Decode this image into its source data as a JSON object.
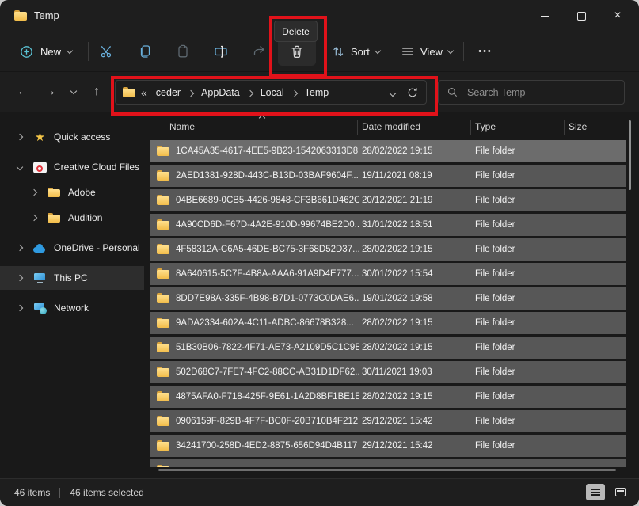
{
  "colors": {
    "annotation_red": "#e1121a",
    "accent_blue": "#6ab1dd",
    "teal_accent": "#5bc4d6",
    "selection_gray": "#575757",
    "focused_row_gray": "#6c6c6c",
    "window_bg": "#1e1e1e",
    "folder_yellow": "#f2bc49"
  },
  "glyphs": {
    "back": "←",
    "forward": "→",
    "up": "↑",
    "overflow": "«",
    "more": "•••",
    "close": "×"
  },
  "window": {
    "title": "Temp"
  },
  "toolbar": {
    "new_label": "New",
    "sort_label": "Sort",
    "view_label": "View",
    "delete_tooltip": "Delete"
  },
  "address_bar": {
    "crumbs": [
      {
        "label": "ceder"
      },
      {
        "label": "AppData"
      },
      {
        "label": "Local"
      },
      {
        "label": "Temp"
      }
    ],
    "search_placeholder": "Search Temp"
  },
  "sidebar": [
    {
      "label": "Quick access",
      "icon": "star",
      "mods": []
    },
    {
      "label": "Creative Cloud Files",
      "icon": "cc",
      "mods": [
        "gap",
        "expanded"
      ]
    },
    {
      "label": "Adobe",
      "icon": "folder",
      "mods": [
        "indent"
      ]
    },
    {
      "label": "Audition",
      "icon": "folder",
      "mods": [
        "indent"
      ]
    },
    {
      "label": "OneDrive - Personal",
      "icon": "onedrive",
      "mods": [
        "gap"
      ]
    },
    {
      "label": "This PC",
      "icon": "pc",
      "mods": [
        "gap",
        "selected"
      ]
    },
    {
      "label": "Network",
      "icon": "network",
      "mods": [
        "gap"
      ]
    }
  ],
  "file_list": {
    "columns": {
      "name": "Name",
      "date": "Date modified",
      "type": "Type",
      "size": "Size"
    },
    "sorted_by": "Name",
    "rows": [
      {
        "name": "1CA45A35-4617-4EE5-9B23-1542063313D8",
        "date": "28/02/2022 19:15",
        "type": "File folder",
        "size": "",
        "mods": [
          "focused"
        ]
      },
      {
        "name": "2AED1381-928D-443C-B13D-03BAF9604F...",
        "date": "19/11/2021 08:19",
        "type": "File folder",
        "size": "",
        "mods": []
      },
      {
        "name": "04BE6689-0CB5-4426-9848-CF3B661D462C",
        "date": "20/12/2021 21:19",
        "type": "File folder",
        "size": "",
        "mods": []
      },
      {
        "name": "4A90CD6D-F67D-4A2E-910D-99674BE2D0...",
        "date": "31/01/2022 18:51",
        "type": "File folder",
        "size": "",
        "mods": []
      },
      {
        "name": "4F58312A-C6A5-46DE-BC75-3F68D52D37...",
        "date": "28/02/2022 19:15",
        "type": "File folder",
        "size": "",
        "mods": []
      },
      {
        "name": "8A640615-5C7F-4B8A-AAA6-91A9D4E777...",
        "date": "30/01/2022 15:54",
        "type": "File folder",
        "size": "",
        "mods": []
      },
      {
        "name": "8DD7E98A-335F-4B98-B7D1-0773C0DAE6...",
        "date": "19/01/2022 19:58",
        "type": "File folder",
        "size": "",
        "mods": []
      },
      {
        "name": "9ADA2334-602A-4C11-ADBC-86678B328...",
        "date": "28/02/2022 19:15",
        "type": "File folder",
        "size": "",
        "mods": []
      },
      {
        "name": "51B30B06-7822-4F71-AE73-A2109D5C1C9B",
        "date": "28/02/2022 19:15",
        "type": "File folder",
        "size": "",
        "mods": []
      },
      {
        "name": "502D68C7-7FE7-4FC2-88CC-AB31D1DF62...",
        "date": "30/11/2021 19:03",
        "type": "File folder",
        "size": "",
        "mods": []
      },
      {
        "name": "4875AFA0-F718-425F-9E61-1A2D8BF1BE1E",
        "date": "28/02/2022 19:15",
        "type": "File folder",
        "size": "",
        "mods": []
      },
      {
        "name": "0906159F-829B-4F7F-BC0F-20B710B4F212",
        "date": "29/12/2021 15:42",
        "type": "File folder",
        "size": "",
        "mods": []
      },
      {
        "name": "34241700-258D-4ED2-8875-656D94D4B117",
        "date": "29/12/2021 15:42",
        "type": "File folder",
        "size": "",
        "mods": []
      },
      {
        "name": "",
        "date": "",
        "type": "",
        "size": "",
        "mods": [
          "partial"
        ]
      }
    ]
  },
  "status_bar": {
    "count": "46 items",
    "selected": "46 items selected"
  }
}
